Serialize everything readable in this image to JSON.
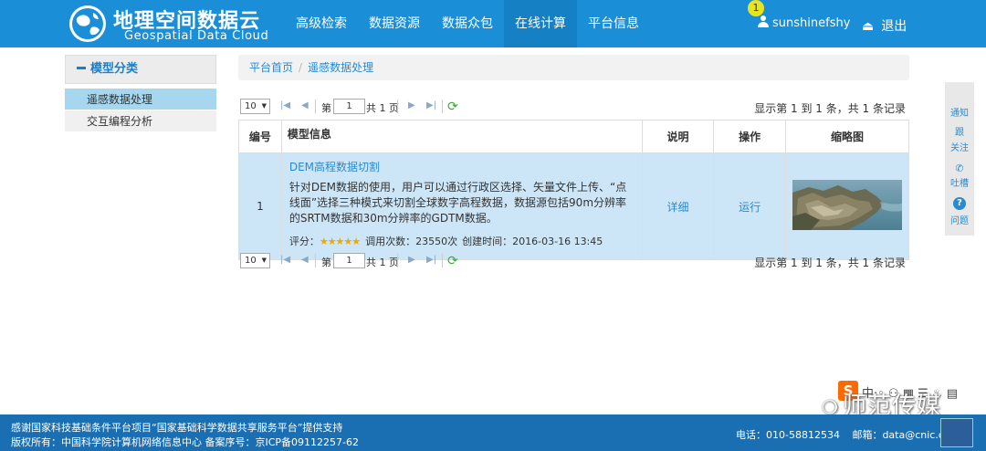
{
  "header": {
    "logo_cn": "地理空间数据云",
    "logo_en": "Geospatial Data Cloud",
    "nav": [
      "高级检索",
      "数据资源",
      "数据众包",
      "在线计算",
      "平台信息"
    ],
    "active_nav": "在线计算",
    "notification_count": "1",
    "username": "sunshinefshy",
    "logout": "退出"
  },
  "sidebar": {
    "title": "模型分类",
    "items": [
      "遥感数据处理",
      "交互编程分析"
    ],
    "active_item": "遥感数据处理"
  },
  "breadcrumb": {
    "home": "平台首页",
    "current": "遥感数据处理"
  },
  "pager": {
    "page_size": "10",
    "page_prefix": "第",
    "page_value": "1",
    "page_suffix": "共 1 页",
    "summary": "显示第 1 到 1 条，共 1 条记录"
  },
  "table": {
    "columns": [
      "编号",
      "模型信息",
      "说明",
      "操作",
      "缩略图"
    ],
    "rows": [
      {
        "num": "1",
        "title": "DEM高程数据切割",
        "description": "针对DEM数据的使用，用户可以通过行政区选择、矢量文件上传、“点线面”选择三种模式来切割全球数字高程数据，数据源包括90m分辨率的SRTM数据和30m分辨率的GDTM数据。",
        "rating_label": "评分：",
        "stars": "★★★★★",
        "calls_label": "调用次数：",
        "calls": "23550次",
        "created_label": "创建时间：",
        "created": "2016-03-16 13:45",
        "detail": "详细",
        "run": "运行"
      }
    ]
  },
  "float_panel": {
    "notice": "通知",
    "follow_1": "跟",
    "follow_2": "关注",
    "feedback": "吐槽",
    "help": "问题",
    "help_icon": "?"
  },
  "footer": {
    "line1": "感谢国家科技基础条件平台项目“国家基础科学数据共享服务平台”提供支持",
    "line2": "版权所有：中国科学院计算机网络信息中心 备案序号：京ICP备09112257-62",
    "phone": "电话：010-58812534",
    "email": "邮箱：data@cnic.cn"
  },
  "watermark": {
    "text": "师范传媒",
    "sogou": "S",
    "toolbar": "中·◦ ⚇ ▦ ☰ ♨ ▤"
  },
  "colors": {
    "header_bg": "#1a8fd8",
    "footer_bg": "#1a6fb3",
    "row_selected": "#cde6f7",
    "link": "#2a8ad0",
    "star": "#f0a800"
  }
}
